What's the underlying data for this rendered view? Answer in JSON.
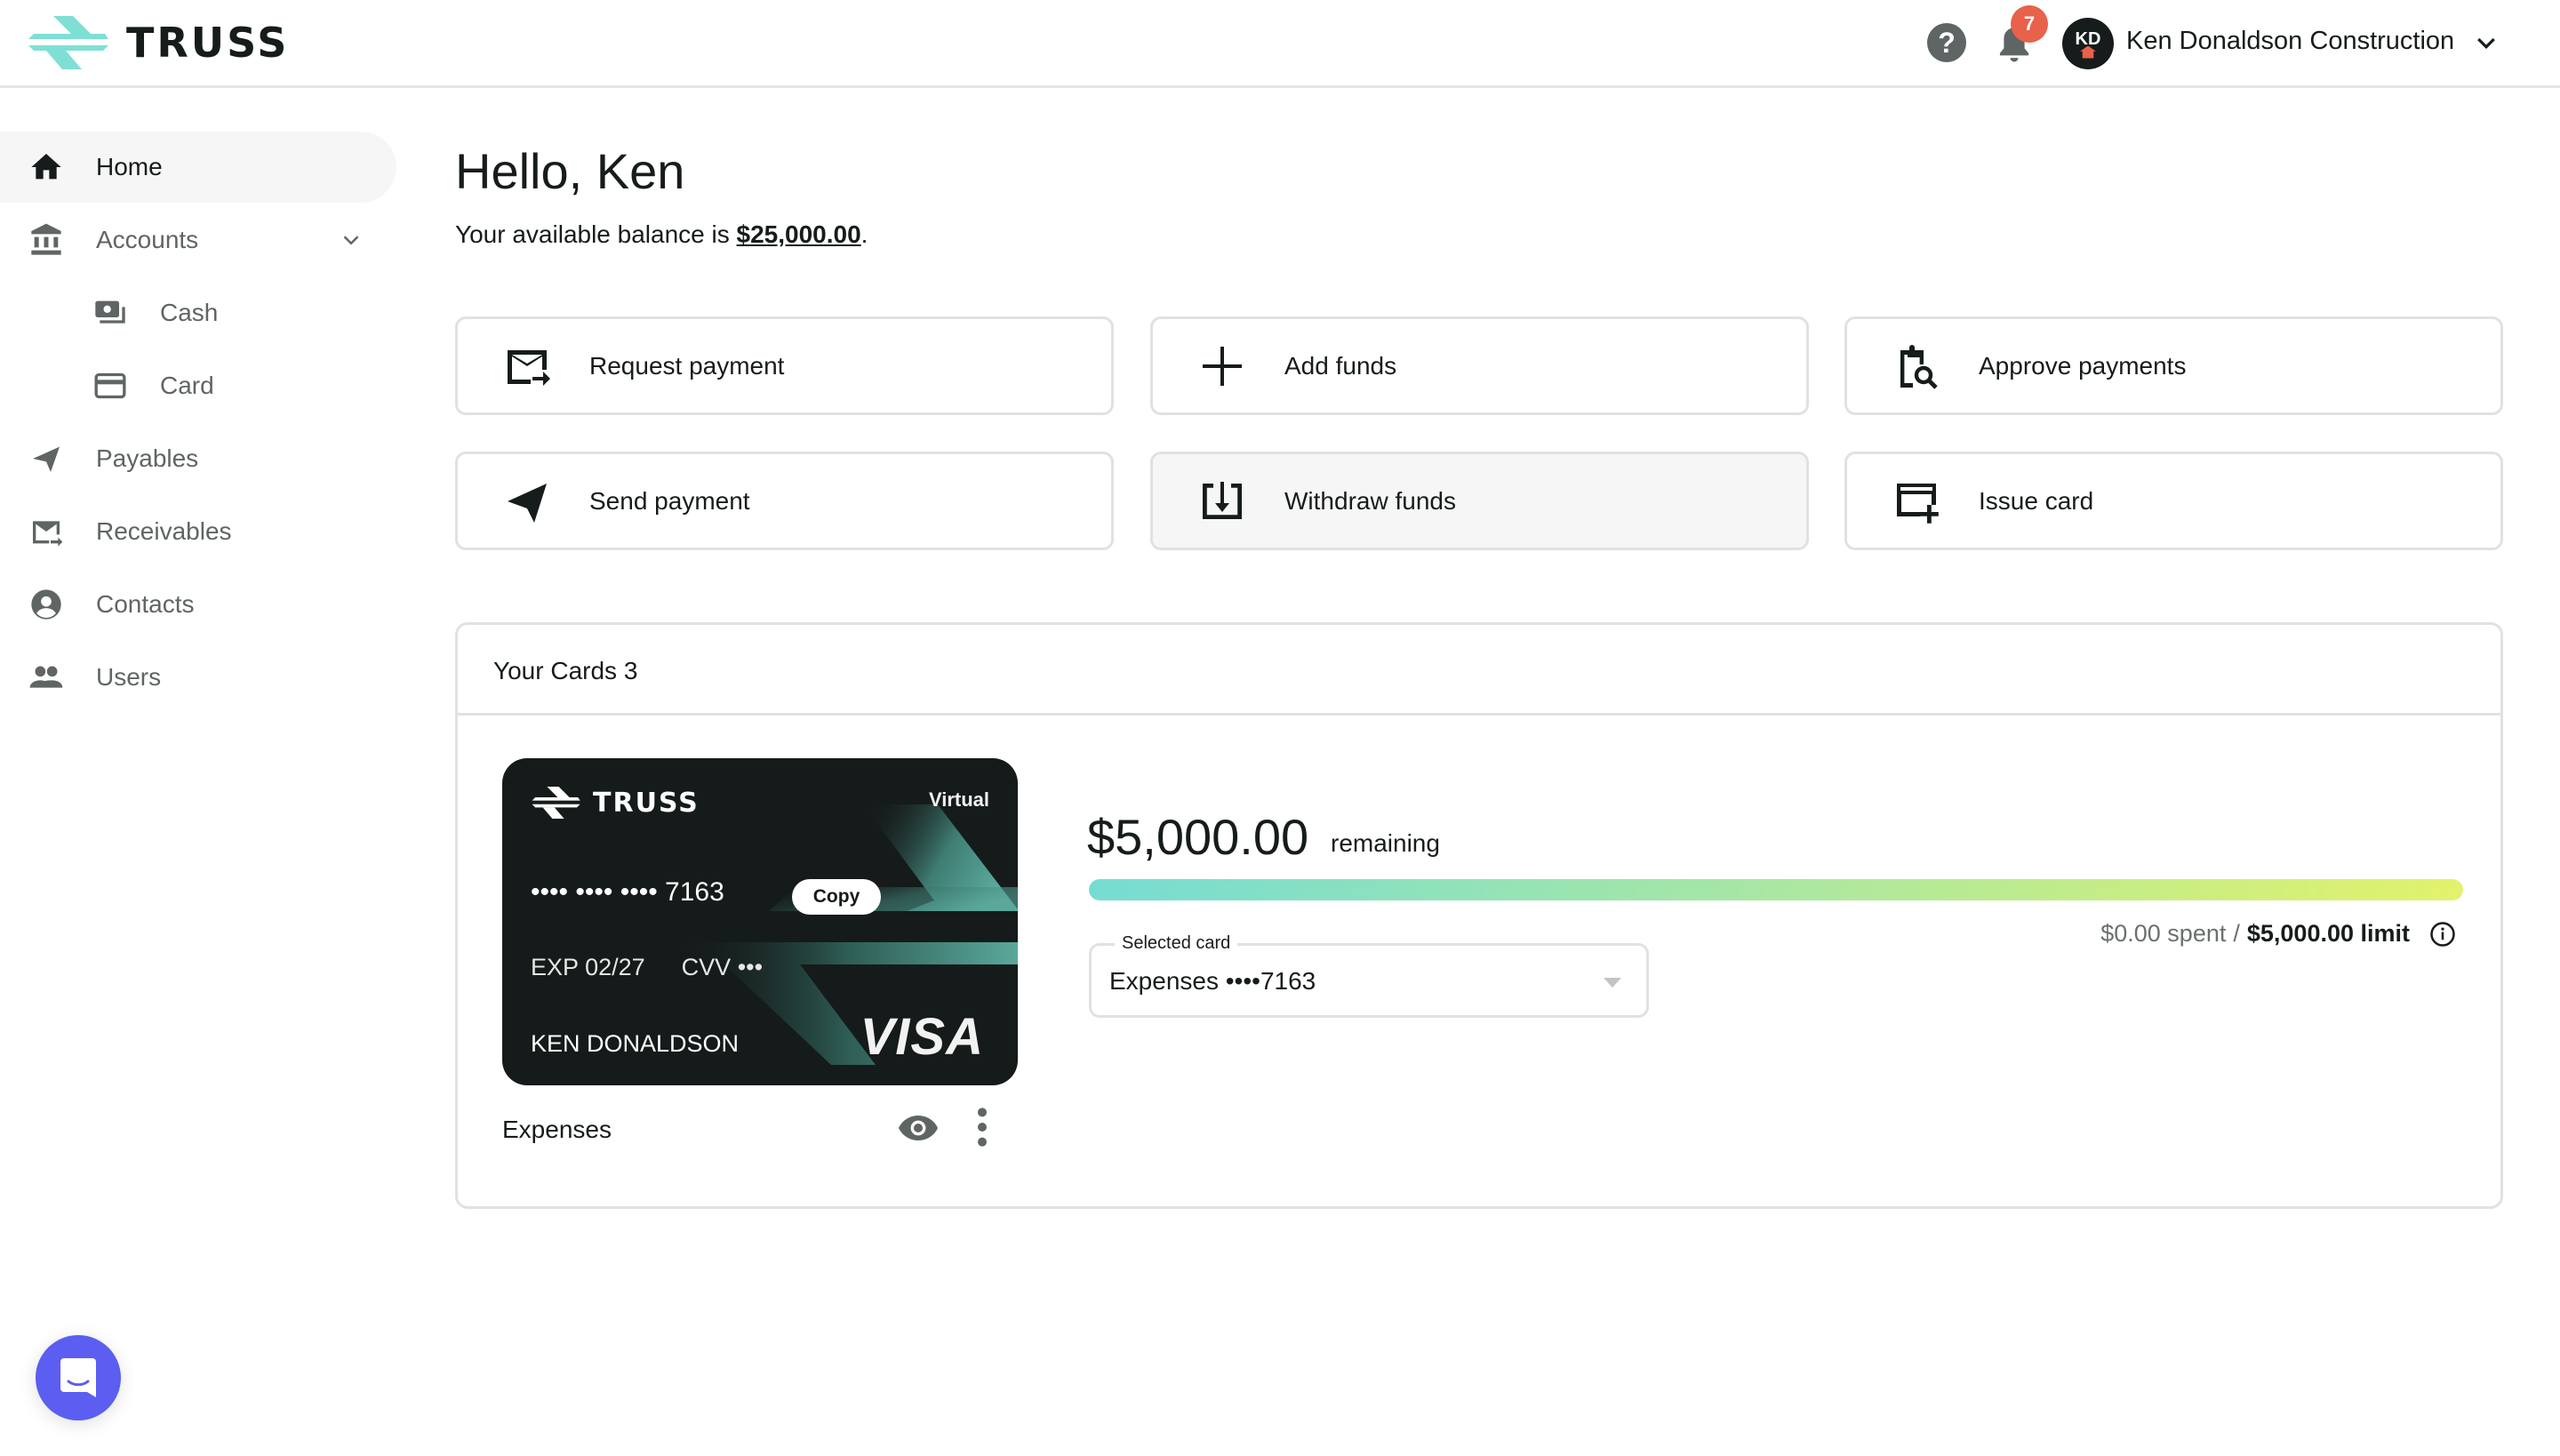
{
  "header": {
    "brand": "TRUSS",
    "help_icon": "question-circle-icon",
    "notifications_icon": "bell-icon",
    "notification_count": "7",
    "avatar_initials": "KD",
    "organization": "Ken Donaldson Construction",
    "org_menu_icon": "chevron-down-icon",
    "brand_color": "#7fdfd4",
    "badge_color": "#e8614a"
  },
  "sidebar": {
    "items": [
      {
        "label": "Home",
        "icon": "home-icon",
        "active": true
      },
      {
        "label": "Accounts",
        "icon": "bank-icon",
        "expanded": true
      },
      {
        "label": "Cash",
        "icon": "cash-icon",
        "sub": true
      },
      {
        "label": "Card",
        "icon": "credit-card-icon",
        "sub": true
      },
      {
        "label": "Payables",
        "icon": "send-icon"
      },
      {
        "label": "Receivables",
        "icon": "mail-arrow-icon"
      },
      {
        "label": "Contacts",
        "icon": "account-circle-icon"
      },
      {
        "label": "Users",
        "icon": "people-icon"
      }
    ]
  },
  "main": {
    "greeting": "Hello, Ken",
    "balance_prefix": "Your available balance is ",
    "balance_amount": "$25,000.00",
    "balance_suffix": ".",
    "actions": [
      {
        "label": "Request payment",
        "icon": "mail-request-icon"
      },
      {
        "label": "Add funds",
        "icon": "plus-icon"
      },
      {
        "label": "Approve payments",
        "icon": "clipboard-search-icon"
      },
      {
        "label": "Send payment",
        "icon": "send-icon"
      },
      {
        "label": "Withdraw funds",
        "icon": "download-box-icon"
      },
      {
        "label": "Issue card",
        "icon": "card-plus-icon"
      }
    ]
  },
  "cards_panel": {
    "title": "Your Cards",
    "count": "3",
    "card": {
      "brand": "TRUSS",
      "type": "Virtual",
      "number_masked": "•••• •••• •••• 7163",
      "copy_label": "Copy",
      "exp_label": "EXP",
      "exp": "02/27",
      "cvv_label": "CVV",
      "cvv_masked": "•••",
      "holder": "KEN DONALDSON",
      "network": "VISA",
      "nickname": "Expenses"
    },
    "remaining_amount": "$5,000.00",
    "remaining_label": "remaining",
    "remaining_fraction": 1.0,
    "spent": "$0.00 spent",
    "separator": " / ",
    "limit": "$5,000.00 limit",
    "select": {
      "label": "Selected card",
      "value": "Expenses ••••7163"
    }
  },
  "chat": {
    "icon": "chat-bubble-icon",
    "color": "#5b5ef0"
  }
}
